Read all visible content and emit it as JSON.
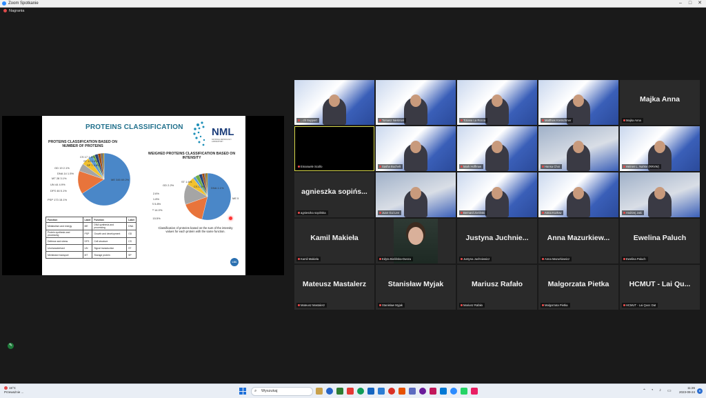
{
  "window": {
    "title": "Zoom Spotkanie",
    "controls": [
      "–",
      "□",
      "✕"
    ]
  },
  "recording": {
    "label": "Nagrania"
  },
  "slide": {
    "title": "PROTEINS CLASSIFICATION",
    "logo_text": "NML",
    "logo_sub": "NATIONAL METROLOGY LABORATORY",
    "section1": "PROTEINS CLASSIFICATION BASED ON NUMBER OF PROTEINS",
    "section2": "WEIGHED PROTEINS CLASSIFICATION BASED ON INTENSITY",
    "caption": "Classification of proteins based on the sum of the intensity values for each protein with the same function.",
    "badge": "LSC",
    "pie1": [
      {
        "label": "ME 345",
        "pct": "69.2%",
        "value": 69.2,
        "color": "#4a87c8"
      },
      {
        "label": "PSP 173",
        "pct": "15.1%",
        "value": 15.1,
        "color": "#e8743b"
      },
      {
        "label": "DFS 46",
        "pct": "5.1%",
        "value": 5.1,
        "color": "#a5a5a5"
      },
      {
        "label": "UN 44",
        "pct": "4.9%",
        "value": 4.9,
        "color": "#f2c12e"
      },
      {
        "label": "MT 28",
        "pct": "3.1%",
        "value": 3.1,
        "color": "#5b9bd5"
      },
      {
        "label": "DNA 14",
        "pct": "1.5%",
        "value": 1.5,
        "color": "#70ad47"
      },
      {
        "label": "GD 19",
        "pct": "2.1%",
        "value": 2.1,
        "color": "#264478"
      },
      {
        "label": "CS 17",
        "pct": "1.9%",
        "value": 1.9,
        "color": "#9e480e"
      },
      {
        "label": "ST 13",
        "pct": "1.4%",
        "value": 1.4,
        "color": "#636363"
      },
      {
        "label": "SP 7",
        "pct": "0.8%",
        "value": 0.8,
        "color": "#997300"
      }
    ],
    "pie2": [
      {
        "label": "ME",
        "pct": "53.4%",
        "value": 53.4,
        "color": "#4a87c8"
      },
      {
        "label": "SP",
        "pct": "15.5%",
        "value": 15.5,
        "color": "#e8743b"
      },
      {
        "label": "PSP",
        "pct": "14.0%",
        "value": 14.0,
        "color": "#a5a5a5"
      },
      {
        "label": "DFS",
        "pct": "5.8%",
        "value": 5.8,
        "color": "#f2c12e"
      },
      {
        "label": "UN",
        "pct": "1.8%",
        "value": 1.8,
        "color": "#5b9bd5"
      },
      {
        "label": "MT",
        "pct": "2.6%",
        "value": 2.6,
        "color": "#70ad47"
      },
      {
        "label": "GD",
        "pct": "2.2%",
        "value": 2.2,
        "color": "#264478"
      },
      {
        "label": "ST",
        "pct": "1.6%",
        "value": 1.6,
        "color": "#9e480e"
      },
      {
        "label": "CS",
        "pct": "1.1%",
        "value": 1.1,
        "color": "#636363"
      },
      {
        "label": "DNA",
        "pct": "1.1%",
        "value": 1.1,
        "color": "#997300"
      }
    ],
    "table": {
      "headers": [
        "Function",
        "Label",
        "Function",
        "Label"
      ],
      "rows": [
        [
          "Metabolism and energy",
          "ME",
          "DNA synthesis and processing",
          "DNA"
        ],
        [
          "Protein synthesis and processing",
          "PSP",
          "Growth and development",
          "GD"
        ],
        [
          "Defense and stress",
          "DFS",
          "Cell structure",
          "CS"
        ],
        [
          "Uncharacterised",
          "UN",
          "Signal transduction",
          "ST"
        ],
        [
          "Membrane transport",
          "MT",
          "Storage protein",
          "SP"
        ]
      ]
    }
  },
  "participants": [
    {
      "name": "...ch Support",
      "type": "video",
      "bg": "slide"
    },
    {
      "name": "Tomasz Nieśmiał",
      "type": "video",
      "bg": "slide"
    },
    {
      "name": "Tiziana La Rocca",
      "type": "video",
      "bg": "slide"
    },
    {
      "name": "Matthias Kretschmer",
      "type": "video",
      "bg": "slide"
    },
    {
      "name": "Majka Anna",
      "type": "name",
      "big": "Majka Anna"
    },
    {
      "name": "Emanuele Scollo",
      "type": "black",
      "active": true
    },
    {
      "name": "Sasha Buchelt",
      "type": "video",
      "bg": "slide"
    },
    {
      "name": "Mark Hoffman",
      "type": "video",
      "bg": "slide"
    },
    {
      "name": "Hansa Choi",
      "type": "video",
      "bg": "room"
    },
    {
      "name": "Heinen L. Nahke (RRVW)",
      "type": "video",
      "bg": "slide"
    },
    {
      "name": "agnieszka sopińska",
      "type": "name",
      "big": "agnieszka sopińs..."
    },
    {
      "name": "Juan Gui Lee",
      "type": "video",
      "bg": "room"
    },
    {
      "name": "Bernard Zieliński",
      "type": "video",
      "bg": "slide"
    },
    {
      "name": "Anna Kozłow",
      "type": "video",
      "bg": "slide"
    },
    {
      "name": "Andrzej Jaki",
      "type": "video",
      "bg": "room"
    },
    {
      "name": "Kamil Makieła",
      "type": "name",
      "big": "Kamil Makieła"
    },
    {
      "name": "Edyta Bielińska-Dusza",
      "type": "photo"
    },
    {
      "name": "Justyna Juchniewicz",
      "type": "name",
      "big": "Justyna Juchnie..."
    },
    {
      "name": "Anna Mazurkiewicz",
      "type": "name",
      "big": "Anna Mazurkiew..."
    },
    {
      "name": "Ewelina Paluch",
      "type": "name",
      "big": "Ewelina Paluch"
    },
    {
      "name": "Mateusz Mastalerz",
      "type": "name",
      "big": "Mateusz Mastalerz"
    },
    {
      "name": "Stanisław Myjak",
      "type": "name",
      "big": "Stanisław Myjak"
    },
    {
      "name": "Mariusz Rafało",
      "type": "name",
      "big": "Mariusz Rafało"
    },
    {
      "name": "Malgorzata Pietka",
      "type": "name",
      "big": "Malgorzata Pietka"
    },
    {
      "name": "HCMUT - Lai Quoc Dat",
      "type": "name",
      "big": "HCMUT - Lai Qu..."
    }
  ],
  "taskbar": {
    "weather_temp": "15°C",
    "weather_desc": "Przeważnie ...",
    "search_placeholder": "Wyszukaj",
    "time": "11:26",
    "date": "2023-09-24",
    "icons": [
      "#c8a04a",
      "#2563c7",
      "#2e7d32",
      "#e53935",
      "#0f9d58",
      "#1565c0",
      "#2b7cd3",
      "#d93025",
      "#e65100",
      "#5c6bc0",
      "#6a1b9a",
      "#c2185b",
      "#0078d4",
      "#2d8cff",
      "#25d366",
      "#e91e63"
    ]
  }
}
